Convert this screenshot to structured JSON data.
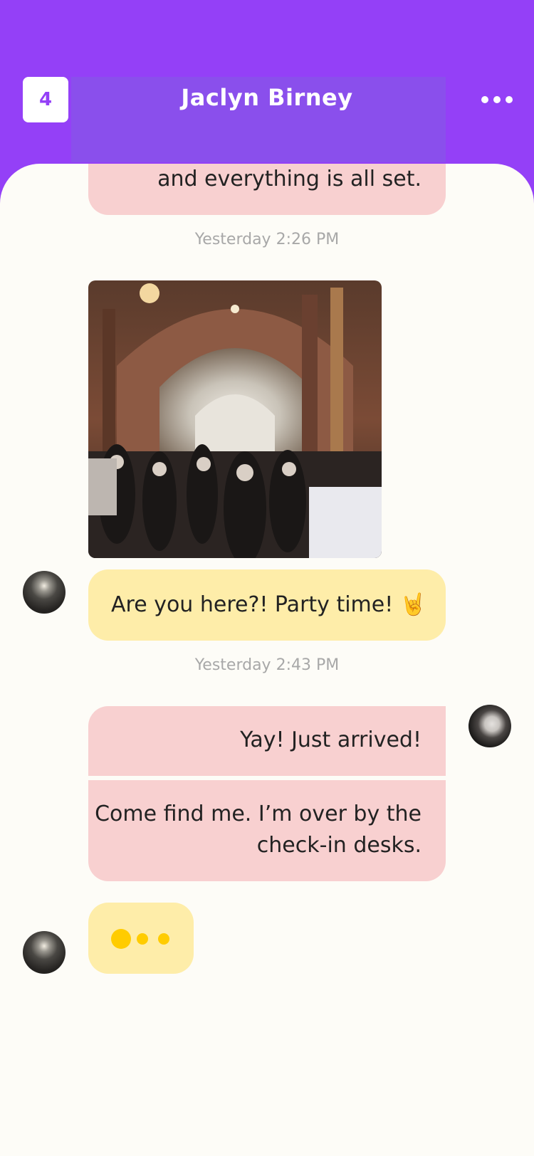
{
  "header": {
    "badge_count": "4",
    "title": "Jaclyn Birney",
    "more_label": "•••"
  },
  "messages": {
    "top_partial": "and everything is all set.",
    "time1": "Yesterday 2:26 PM",
    "photo_alt": "",
    "msg_party": "Are you here?! Party time! 🤘",
    "time2": "Yesterday 2:43 PM",
    "msg_arrived": "Yay! Just arrived!",
    "msg_find_line1": "Come find me. I’m over by the",
    "msg_find_line2": "check-in desks."
  },
  "colors": {
    "accent": "#9440f7",
    "sent_bubble": "#f8d0d0",
    "received_bubble": "#feeda9",
    "typing_dot": "#ffcc00"
  }
}
